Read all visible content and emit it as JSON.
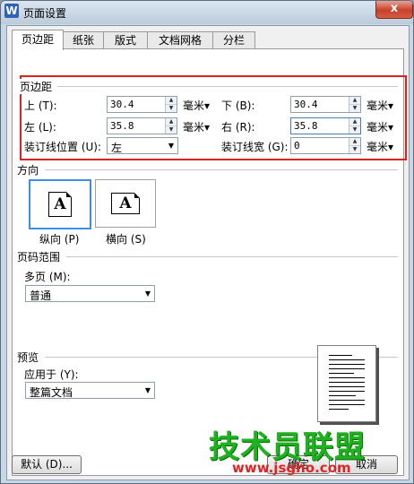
{
  "window": {
    "title": "页面设置",
    "app_icon": "W",
    "close_label": "x"
  },
  "tabs": [
    {
      "label": "页边距",
      "active": true
    },
    {
      "label": "纸张",
      "active": false
    },
    {
      "label": "版式",
      "active": false
    },
    {
      "label": "文档网格",
      "active": false
    },
    {
      "label": "分栏",
      "active": false
    }
  ],
  "margins": {
    "group_title": "页边距",
    "top": {
      "label": "上 (T):",
      "value": "30.4",
      "unit": "毫米▾"
    },
    "bottom": {
      "label": "下 (B):",
      "value": "30.4",
      "unit": "毫米▾"
    },
    "left": {
      "label": "左 (L):",
      "value": "35.8",
      "unit": "毫米▾"
    },
    "right": {
      "label": "右 (R):",
      "value": "35.8",
      "unit": "毫米▾"
    },
    "gutter_position": {
      "label": "装订线位置 (U):",
      "value": "左"
    },
    "gutter_width": {
      "label": "装订线宽 (G):",
      "value": "0",
      "unit": "毫米▾"
    }
  },
  "orientation": {
    "group_title": "方向",
    "portrait": {
      "label": "纵向 (P)",
      "icon_letter": "A",
      "selected": true
    },
    "landscape": {
      "label": "横向 (S)",
      "icon_letter": "A",
      "selected": false
    }
  },
  "page_range": {
    "group_title": "页码范围",
    "multiple_pages_label": "多页 (M):",
    "multiple_pages_value": "普通"
  },
  "preview": {
    "group_title": "预览",
    "apply_to_label": "应用于 (Y):",
    "apply_to_value": "整篇文档"
  },
  "buttons": {
    "default": "默认 (D)...",
    "ok": "确定",
    "cancel": "取消"
  },
  "watermark": {
    "text": "技术员联盟",
    "url": "www.jsgho.com"
  },
  "colors": {
    "highlight_box": "#e02020",
    "selected_border": "#3d8ee6",
    "watermark_green": "#1fb21f",
    "watermark_red": "#e02424"
  }
}
